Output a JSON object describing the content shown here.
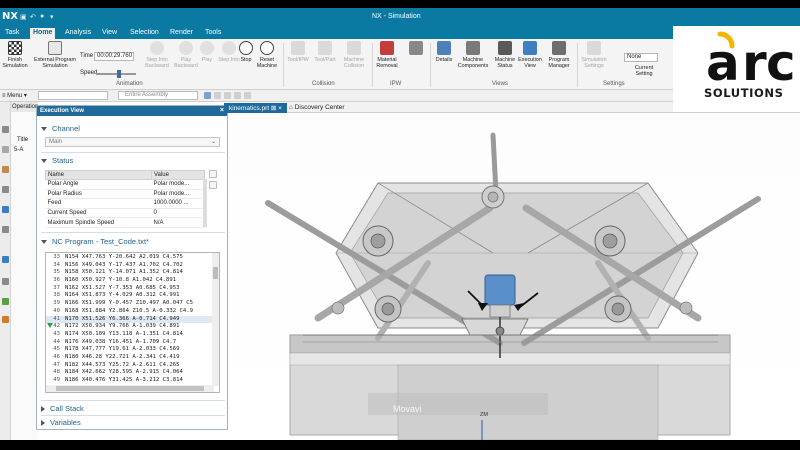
{
  "app": {
    "logo": "NX",
    "window_title": "NX - Simulation",
    "quick_access": [
      "Task",
      "Home",
      "Analysis",
      "View",
      "Selection",
      "Render",
      "Tools"
    ],
    "active_tab": "Home"
  },
  "ribbon": {
    "finish_sim": "Finish Simulation",
    "external_prog": "External Program Simulation",
    "time_label": "Time",
    "time_value": "00:00:29.760",
    "speed_label": "Speed",
    "step_into_backward": "Step Into Backward",
    "play_backward": "Play Backward",
    "play": "Play",
    "step_into": "Step Into",
    "stop": "Stop",
    "reset_machine": "Reset Machine",
    "tool_ipw": "Tool/IPW",
    "tool_part": "Tool/Part",
    "machine_collision": "Machine Collision",
    "material_removal": "Material Removal",
    "details": "Details",
    "machine_components": "Machine Components",
    "machine_status": "Machine Status",
    "execution_view": "Execution View",
    "program_manager": "Program Manager",
    "simulation_settings": "Simulation Settings",
    "none_value": "None",
    "current_setting": "Current Setting",
    "groups": [
      "Animation",
      "Collision",
      "IPW",
      "Views",
      "Settings"
    ]
  },
  "toolbar": {
    "menu": "Menu",
    "assembly_filter": "Entire Assembly"
  },
  "navigator": {
    "tab": "Operation Navigator",
    "title_col": "Title",
    "node": "5-A"
  },
  "doc_tabs": [
    "kinematics.prt",
    "Discovery Center"
  ],
  "exec_view": {
    "header": "Execution View",
    "close": "×",
    "channel": {
      "title": "Channel",
      "selected": "Main"
    },
    "status": {
      "title": "Status",
      "columns": [
        "Name",
        "Value"
      ],
      "rows": [
        [
          "Polar Angle",
          "Polar mode..."
        ],
        [
          "Polar Radius",
          "Polar mode..."
        ],
        [
          "Feed",
          "1000.0000 ..."
        ],
        [
          "Current Speed",
          "0"
        ],
        [
          "Maximum Spindle Speed",
          "N/A"
        ]
      ]
    },
    "nc_program": {
      "title": "NC Program - Test_Code.txt*",
      "current_line": "41",
      "lines": [
        [
          "33",
          "N154 X47.763 Y-20.642 A2.019 C4.575"
        ],
        [
          "34",
          "N156 X49.043 Y-17.437 A1.702 C4.702"
        ],
        [
          "35",
          "N158 X50.121 Y-14.071 A1.352 C4.814"
        ],
        [
          "36",
          "N160 X50.927 Y-10.8 A1.042 C4.891"
        ],
        [
          "37",
          "N162 X51.527 Y-7.353 A0.685 C4.953"
        ],
        [
          "38",
          "N164 X51.873 Y-4.029 A0.312 C4.991"
        ],
        [
          "39",
          "N166 X51.999 Y-0.457 Z10.497 A0.047 C5"
        ],
        [
          "40",
          "N168 X51.884 Y2.864 Z10.5 A-0.332 C4.9"
        ],
        [
          "41",
          "N170 X51.526 Y6.366 A-0.714 C4.949"
        ],
        [
          "42",
          "N172 X50.934 Y9.766 A-1.039 C4.891"
        ],
        [
          "43",
          "N174 X50.109 Y13.118 A-1.351 C4.814"
        ],
        [
          "44",
          "N176 X49.038 Y16.451 A-1.709 C4.7"
        ],
        [
          "45",
          "N178 X47.777 Y19.61 A-2.033 C4.569"
        ],
        [
          "46",
          "N180 X46.28 Y22.721 A-2.341 C4.419"
        ],
        [
          "47",
          "N182 X44.573 Y25.72 A-2.611 C4.265"
        ],
        [
          "48",
          "N184 X42.662 Y28.595 A-2.915 C4.064"
        ],
        [
          "49",
          "N186 X40.476 Y31.425 A-3.212 C3.814"
        ]
      ]
    },
    "call_stack": "Call Stack",
    "variables": "Variables"
  },
  "viewport": {
    "watermark": "Movavi",
    "axis_label": "ZM"
  },
  "brand": {
    "word": "arc",
    "tagline": "SOLUTIONS",
    "accent": "#f4b400"
  },
  "colors": {
    "titlebar": "#0a7aa3",
    "panel_header": "#1f6a9a",
    "section_text": "#1e5f8e"
  }
}
